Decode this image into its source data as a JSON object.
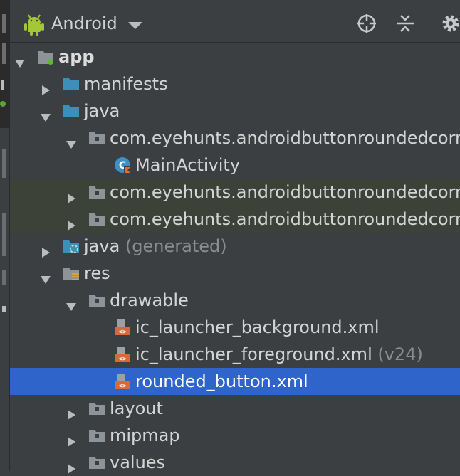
{
  "header": {
    "view_mode": "Android",
    "icons": [
      "target-icon",
      "collapse-all-icon",
      "gear-icon"
    ]
  },
  "tree": [
    {
      "label": "app",
      "suffix": "",
      "indent": 0,
      "arrow": "down",
      "icon": "module-folder-icon",
      "bold": true,
      "state": ""
    },
    {
      "label": "manifests",
      "suffix": "",
      "indent": 1,
      "arrow": "right",
      "icon": "folder-icon",
      "bold": false,
      "state": ""
    },
    {
      "label": "java",
      "suffix": "",
      "indent": 1,
      "arrow": "down",
      "icon": "folder-icon",
      "bold": false,
      "state": ""
    },
    {
      "label": "com.eyehunts.androidbuttonroundedcorners",
      "suffix": "",
      "indent": 2,
      "arrow": "down",
      "icon": "package-icon",
      "bold": false,
      "state": ""
    },
    {
      "label": "MainActivity",
      "suffix": "",
      "indent": 3,
      "arrow": "none",
      "icon": "kotlin-class-icon",
      "bold": false,
      "state": ""
    },
    {
      "label": "com.eyehunts.androidbuttonroundedcorners",
      "suffix": "",
      "indent": 2,
      "arrow": "right",
      "icon": "package-icon",
      "bold": false,
      "state": "highlight"
    },
    {
      "label": "com.eyehunts.androidbuttonroundedcorners",
      "suffix": "",
      "indent": 2,
      "arrow": "right",
      "icon": "package-icon",
      "bold": false,
      "state": "highlight"
    },
    {
      "label": "java",
      "suffix": " (generated)",
      "indent": 1,
      "arrow": "right",
      "icon": "generated-folder-icon",
      "bold": false,
      "state": ""
    },
    {
      "label": "res",
      "suffix": "",
      "indent": 1,
      "arrow": "down",
      "icon": "res-folder-icon",
      "bold": false,
      "state": ""
    },
    {
      "label": "drawable",
      "suffix": "",
      "indent": 2,
      "arrow": "down",
      "icon": "package-icon",
      "bold": false,
      "state": ""
    },
    {
      "label": "ic_launcher_background.xml",
      "suffix": "",
      "indent": 3,
      "arrow": "none",
      "icon": "xml-file-icon",
      "bold": false,
      "state": ""
    },
    {
      "label": "ic_launcher_foreground.xml",
      "suffix": " (v24)",
      "indent": 3,
      "arrow": "none",
      "icon": "xml-file-icon",
      "bold": false,
      "state": ""
    },
    {
      "label": "rounded_button.xml",
      "suffix": "",
      "indent": 3,
      "arrow": "none",
      "icon": "xml-file-icon",
      "bold": false,
      "state": "selected"
    },
    {
      "label": "layout",
      "suffix": "",
      "indent": 2,
      "arrow": "right",
      "icon": "package-icon",
      "bold": false,
      "state": ""
    },
    {
      "label": "mipmap",
      "suffix": "",
      "indent": 2,
      "arrow": "right",
      "icon": "package-icon",
      "bold": false,
      "state": ""
    },
    {
      "label": "values",
      "suffix": "",
      "indent": 2,
      "arrow": "right",
      "icon": "package-icon",
      "bold": false,
      "state": ""
    }
  ],
  "colors": {
    "background": "#3c3f41",
    "selection": "#2f65ca",
    "highlight_row": "#3d4239",
    "folder_blue": "#3b8fb8",
    "xml_orange": "#d66a3b",
    "android_green": "#a4c639"
  }
}
